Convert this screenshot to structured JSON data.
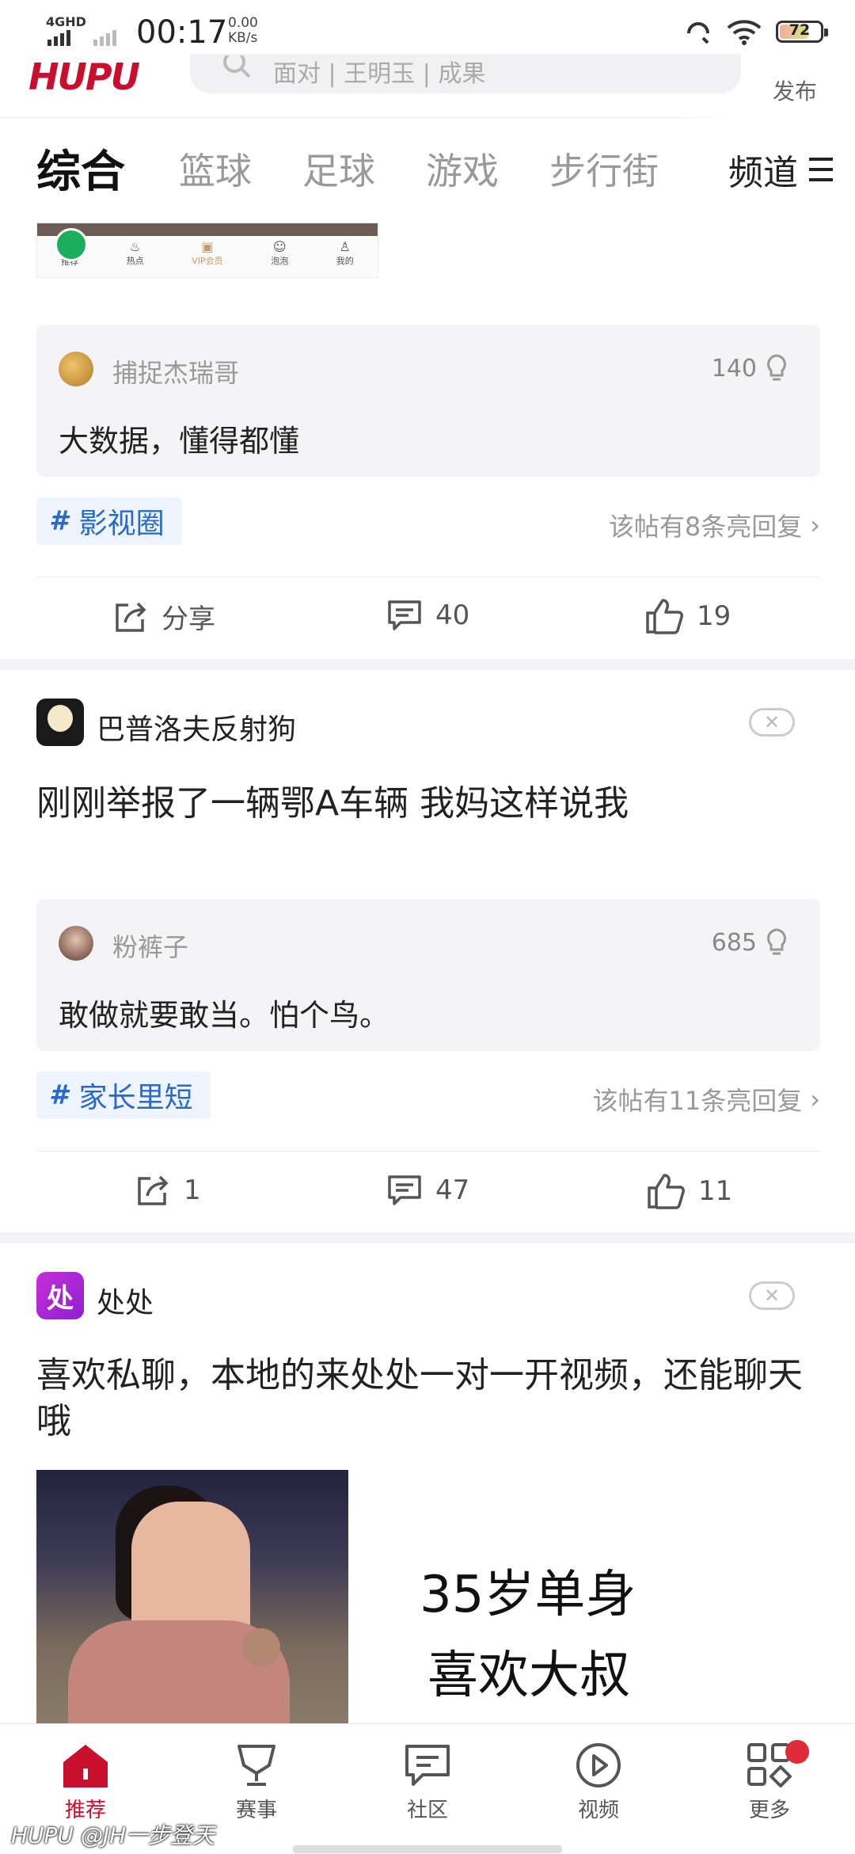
{
  "status_bar": {
    "network": "4GHD",
    "time": "00:17",
    "speed_value": "0.00",
    "speed_unit": "KB/s",
    "battery": "72"
  },
  "header": {
    "logo": "HUPU",
    "search_placeholder": "面对 | 王明玉 | 成果",
    "publish_label": "发布"
  },
  "tabs": [
    {
      "label": "综合",
      "active": true
    },
    {
      "label": "篮球"
    },
    {
      "label": "足球"
    },
    {
      "label": "游戏"
    },
    {
      "label": "步行街"
    }
  ],
  "channel_label": "频道",
  "thumbnail_strip": {
    "items": [
      "推荐",
      "热点",
      "VIP会员",
      "泡泡",
      "我的"
    ]
  },
  "posts": [
    {
      "comment": {
        "user": "捕捉杰瑞哥",
        "likes": "140",
        "text": "大数据，懂得都懂"
      },
      "tag": "影视圈",
      "reply_note": "该帖有8条亮回复",
      "actions": {
        "share": "分享",
        "comments": "40",
        "likes": "19"
      }
    },
    {
      "author": "巴普洛夫反射狗",
      "title": "刚刚举报了一辆鄂A车辆 我妈这样说我",
      "comment": {
        "user": "粉裤子",
        "likes": "685",
        "text": "敢做就要敢当。怕个鸟。"
      },
      "tag": "家长里短",
      "reply_note": "该帖有11条亮回复",
      "actions": {
        "share": "1",
        "comments": "47",
        "likes": "11"
      }
    },
    {
      "author": "处处",
      "author_logo": "处",
      "title": "喜欢私聊，本地的来处处一对一开视频，还能聊天哦",
      "ad_text_line1": "35岁单身",
      "ad_text_line2": "喜欢大叔"
    }
  ],
  "bottom_nav": [
    {
      "label": "推荐",
      "icon": "home-icon",
      "active": true
    },
    {
      "label": "赛事",
      "icon": "trophy-icon"
    },
    {
      "label": "社区",
      "icon": "chat-icon"
    },
    {
      "label": "视频",
      "icon": "play-icon"
    },
    {
      "label": "更多",
      "icon": "grid-icon"
    }
  ],
  "watermark": "HUPU @JH一步登天",
  "colors": {
    "brand_red": "#c8102e",
    "tag_blue": "#2a69c6"
  }
}
